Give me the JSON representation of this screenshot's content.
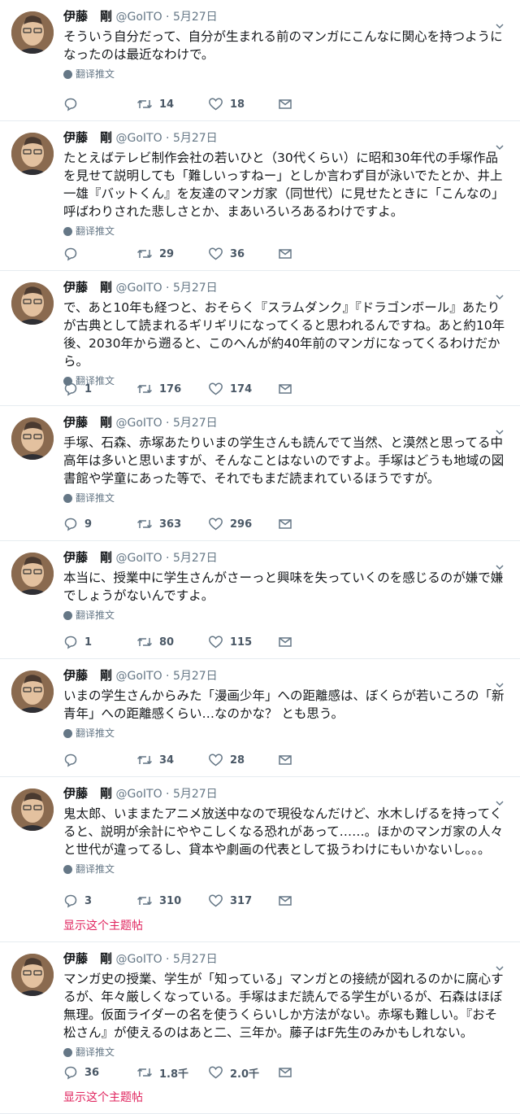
{
  "tweets": [
    {
      "name": "伊藤　剛",
      "handle": "@GoITO",
      "sep": "·",
      "date": "5月27日",
      "text": "そういう自分だって、自分が生まれる前のマンガにこんなに関心を持つようになったのは最近なわけで。",
      "translate_label": "翻译推文",
      "reply_count": "",
      "retweet_count": "14",
      "like_count": "18",
      "show_thread": ""
    },
    {
      "name": "伊藤　剛",
      "handle": "@GoITO",
      "sep": "·",
      "date": "5月27日",
      "text": "たとえばテレビ制作会社の若いひと（30代くらい）に昭和30年代の手塚作品を見せて説明しても「難しいっすねー」としか言わず目が泳いでたとか、井上一雄『バットくん』を友達のマンガ家（同世代）に見せたときに「こんなの」呼ばわりされた悲しさとか、まあいろいろあるわけですよ。",
      "translate_label": "翻译推文",
      "reply_count": "",
      "retweet_count": "29",
      "like_count": "36",
      "show_thread": ""
    },
    {
      "name": "伊藤　剛",
      "handle": "@GoITO",
      "sep": "·",
      "date": "5月27日",
      "text": "で、あと10年も経つと、おそらく『スラムダンク』『ドラゴンボール』あたりが古典として読まれるギリギリになってくると思われるんですね。あと約10年後、2030年から遡ると、このへんが約40年前のマンガになってくるわけだから。",
      "translate_label": "翻译推文",
      "reply_count": "1",
      "retweet_count": "176",
      "like_count": "174",
      "show_thread": ""
    },
    {
      "name": "伊藤　剛",
      "handle": "@GoITO",
      "sep": "·",
      "date": "5月27日",
      "text": "手塚、石森、赤塚あたりいまの学生さんも読んでて当然、と漠然と思ってる中高年は多いと思いますが、そんなことはないのですよ。手塚はどうも地域の図書館や学童にあった等で、それでもまだ読まれているほうですが。",
      "translate_label": "翻译推文",
      "reply_count": "9",
      "retweet_count": "363",
      "like_count": "296",
      "show_thread": ""
    },
    {
      "name": "伊藤　剛",
      "handle": "@GoITO",
      "sep": "·",
      "date": "5月27日",
      "text": "本当に、授業中に学生さんがさーっと興味を失っていくのを感じるのが嫌で嫌でしょうがないんですよ。",
      "translate_label": "翻译推文",
      "reply_count": "1",
      "retweet_count": "80",
      "like_count": "115",
      "show_thread": ""
    },
    {
      "name": "伊藤　剛",
      "handle": "@GoITO",
      "sep": "·",
      "date": "5月27日",
      "text": "いまの学生さんからみた「漫画少年」への距離感は、ぼくらが若いころの「新青年」への距離感くらい…なのかな？ とも思う。",
      "translate_label": "翻译推文",
      "reply_count": "",
      "retweet_count": "34",
      "like_count": "28",
      "show_thread": ""
    },
    {
      "name": "伊藤　剛",
      "handle": "@GoITO",
      "sep": "·",
      "date": "5月27日",
      "text": "鬼太郎、いままたアニメ放送中なので現役なんだけど、水木しげるを持ってくると、説明が余計にややこしくなる恐れがあって……。ほかのマンガ家の人々と世代が違ってるし、貸本や劇画の代表として扱うわけにもいかないし。。。",
      "translate_label": "翻译推文",
      "reply_count": "3",
      "retweet_count": "310",
      "like_count": "317",
      "show_thread": "显示这个主题帖"
    },
    {
      "name": "伊藤　剛",
      "handle": "@GoITO",
      "sep": "·",
      "date": "5月27日",
      "text": "マンガ史の授業、学生が「知っている」マンガとの接続が図れるのかに腐心するが、年々厳しくなっている。手塚はまだ読んでる学生がいるが、石森はほぼ無理。仮面ライダーの名を使うくらいしか方法がない。赤塚も難しい。『おそ松さん』が使えるのはあと二、三年か。藤子はF先生のみかもしれない。",
      "translate_label": "翻译推文",
      "reply_count": "36",
      "retweet_count": "1.8千",
      "like_count": "2.0千",
      "show_thread": "显示这个主题帖"
    }
  ],
  "colors": {
    "accent": "#e0245e",
    "muted": "#657786",
    "border": "#e6ecf0"
  },
  "icons": [
    "reply-icon",
    "retweet-icon",
    "like-icon",
    "message-icon",
    "globe-icon",
    "chevron-down-icon"
  ]
}
